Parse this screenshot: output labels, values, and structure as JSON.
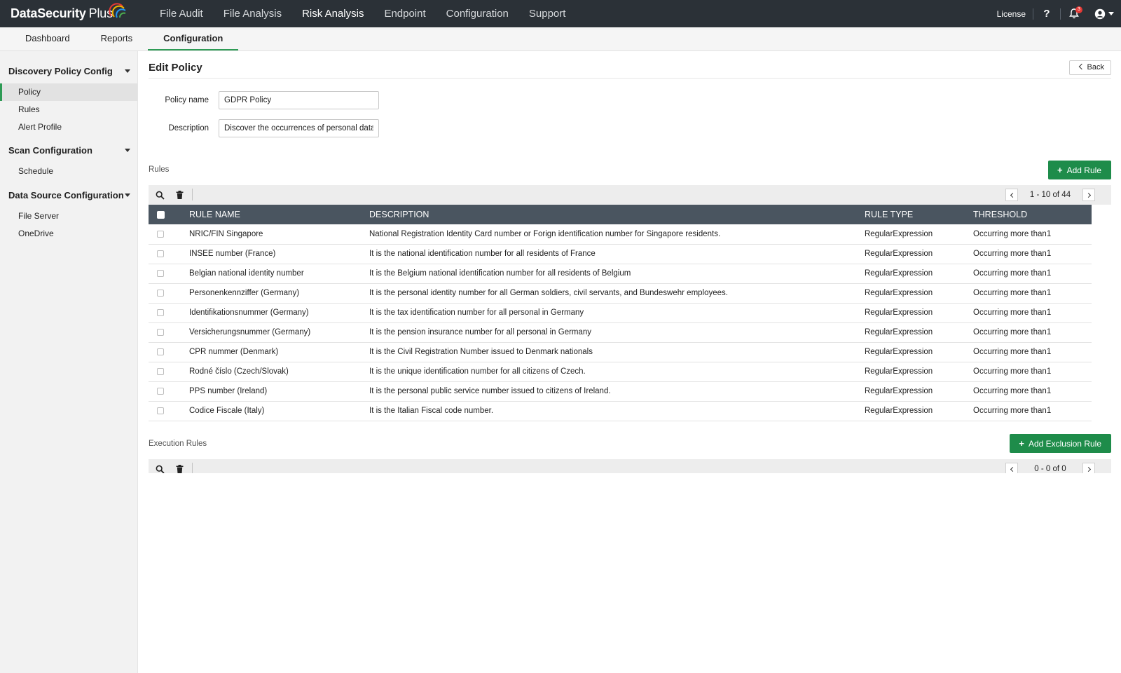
{
  "app": {
    "logo_main": "DataSecurity",
    "logo_plus": "Plus"
  },
  "topnav": [
    {
      "label": "File Audit"
    },
    {
      "label": "File Analysis"
    },
    {
      "label": "Risk Analysis"
    },
    {
      "label": "Endpoint"
    },
    {
      "label": "Configuration"
    },
    {
      "label": "Support"
    }
  ],
  "topbar": {
    "license": "License",
    "help": "?",
    "notification_count": "3"
  },
  "subtabs": [
    {
      "label": "Dashboard"
    },
    {
      "label": "Reports"
    },
    {
      "label": "Configuration"
    }
  ],
  "sidebar": {
    "groups": [
      {
        "label": "Discovery Policy Config",
        "items": [
          {
            "label": "Policy"
          },
          {
            "label": "Rules"
          },
          {
            "label": "Alert Profile"
          }
        ]
      },
      {
        "label": "Scan Configuration",
        "items": [
          {
            "label": "Schedule"
          }
        ]
      },
      {
        "label": "Data Source Configuration",
        "items": [
          {
            "label": "File Server"
          },
          {
            "label": "OneDrive"
          }
        ]
      }
    ]
  },
  "page": {
    "title": "Edit Policy",
    "back": "Back"
  },
  "form": {
    "policy_name_label": "Policy name",
    "policy_name_value": "GDPR Policy",
    "description_label": "Description",
    "description_value": "Discover the occurrences of personal data"
  },
  "rules_section": {
    "label": "Rules",
    "add_button": "Add Rule",
    "pager": "1 - 10 of 44",
    "columns": [
      "RULE NAME",
      "DESCRIPTION",
      "RULE TYPE",
      "THRESHOLD"
    ],
    "rows": [
      {
        "name": "NRIC/FIN Singapore",
        "description": "National Registration Identity Card number or Forign identification number for Singapore residents.",
        "type": "RegularExpression",
        "threshold": "Occurring more than1"
      },
      {
        "name": "INSEE number (France)",
        "description": "It is the national identification number for all residents of France",
        "type": "RegularExpression",
        "threshold": "Occurring more than1"
      },
      {
        "name": "Belgian national identity number",
        "description": "It is the Belgium national identification number for all residents of Belgium",
        "type": "RegularExpression",
        "threshold": "Occurring more than1"
      },
      {
        "name": "Personenkennziffer (Germany)",
        "description": "It is the personal identity number for all German soldiers, civil servants, and Bundeswehr employees.",
        "type": "RegularExpression",
        "threshold": "Occurring more than1"
      },
      {
        "name": "Identifikationsnummer (Germany)",
        "description": "It is the tax identification number for all personal in Germany",
        "type": "RegularExpression",
        "threshold": "Occurring more than1"
      },
      {
        "name": "Versicherungsnummer (Germany)",
        "description": "It is the pension insurance number for all personal in Germany",
        "type": "RegularExpression",
        "threshold": "Occurring more than1"
      },
      {
        "name": "CPR nummer (Denmark)",
        "description": "It is the Civil Registration Number issued to Denmark nationals",
        "type": "RegularExpression",
        "threshold": "Occurring more than1"
      },
      {
        "name": "Rodné číslo (Czech/Slovak)",
        "description": "It is the unique identification number for all citizens of Czech.",
        "type": "RegularExpression",
        "threshold": "Occurring more than1"
      },
      {
        "name": "PPS number (Ireland)",
        "description": "It is the personal public service number issued to citizens of Ireland.",
        "type": "RegularExpression",
        "threshold": "Occurring more than1"
      },
      {
        "name": "Codice Fiscale (Italy)",
        "description": "It is the Italian Fiscal code number.",
        "type": "RegularExpression",
        "threshold": "Occurring more than1"
      }
    ]
  },
  "exec_section": {
    "label": "Execution Rules",
    "add_button": "Add Exclusion Rule",
    "pager": "0 - 0 of 0"
  },
  "colors": {
    "topbar_bg": "#2b3137",
    "accent_green": "#1e8c4a",
    "table_header_bg": "#4a5560",
    "notification_badge": "#e53935"
  }
}
